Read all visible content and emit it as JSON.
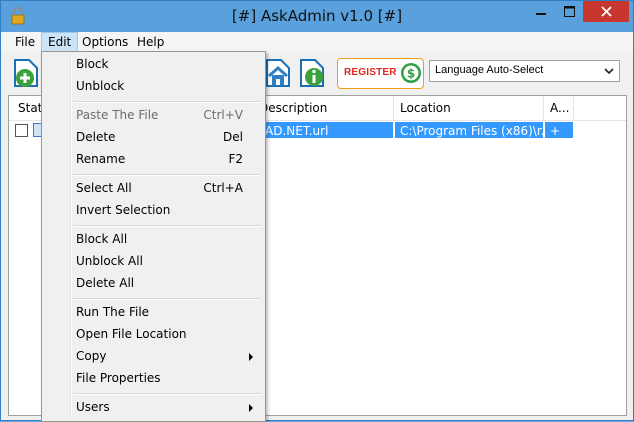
{
  "window": {
    "title": "[#] AskAdmin v1.0 [#]"
  },
  "menubar": {
    "items": [
      "File",
      "Edit",
      "Options",
      "Help"
    ]
  },
  "toolbar": {
    "register_label": "REGISTER",
    "language_select": "Language Auto-Select"
  },
  "list": {
    "columns": [
      "Status",
      "Description",
      "Location",
      "A..."
    ],
    "rows": [
      {
        "description": "AD.NET.url",
        "location": "C:\\Program Files (x86)\\r...",
        "attr": "+"
      }
    ]
  },
  "edit_menu": {
    "items": [
      {
        "label": "Block",
        "shortcut": ""
      },
      {
        "label": "Unblock",
        "shortcut": ""
      },
      {
        "label": "Paste The File",
        "shortcut": "Ctrl+V"
      },
      {
        "label": "Delete",
        "shortcut": "Del"
      },
      {
        "label": "Rename",
        "shortcut": "F2"
      },
      {
        "label": "Select All",
        "shortcut": "Ctrl+A"
      },
      {
        "label": "Invert Selection",
        "shortcut": ""
      },
      {
        "label": "Block All",
        "shortcut": ""
      },
      {
        "label": "Unblock All",
        "shortcut": ""
      },
      {
        "label": "Delete All",
        "shortcut": ""
      },
      {
        "label": "Run The File",
        "shortcut": ""
      },
      {
        "label": "Open File Location",
        "shortcut": ""
      },
      {
        "label": "Copy",
        "shortcut": ""
      },
      {
        "label": "File Properties",
        "shortcut": ""
      },
      {
        "label": "Users",
        "shortcut": ""
      }
    ]
  },
  "colors": {
    "titlebar": "#5aa0dc",
    "selection": "#3399ff",
    "close": "#c7372e",
    "register_text": "#e0281e"
  }
}
